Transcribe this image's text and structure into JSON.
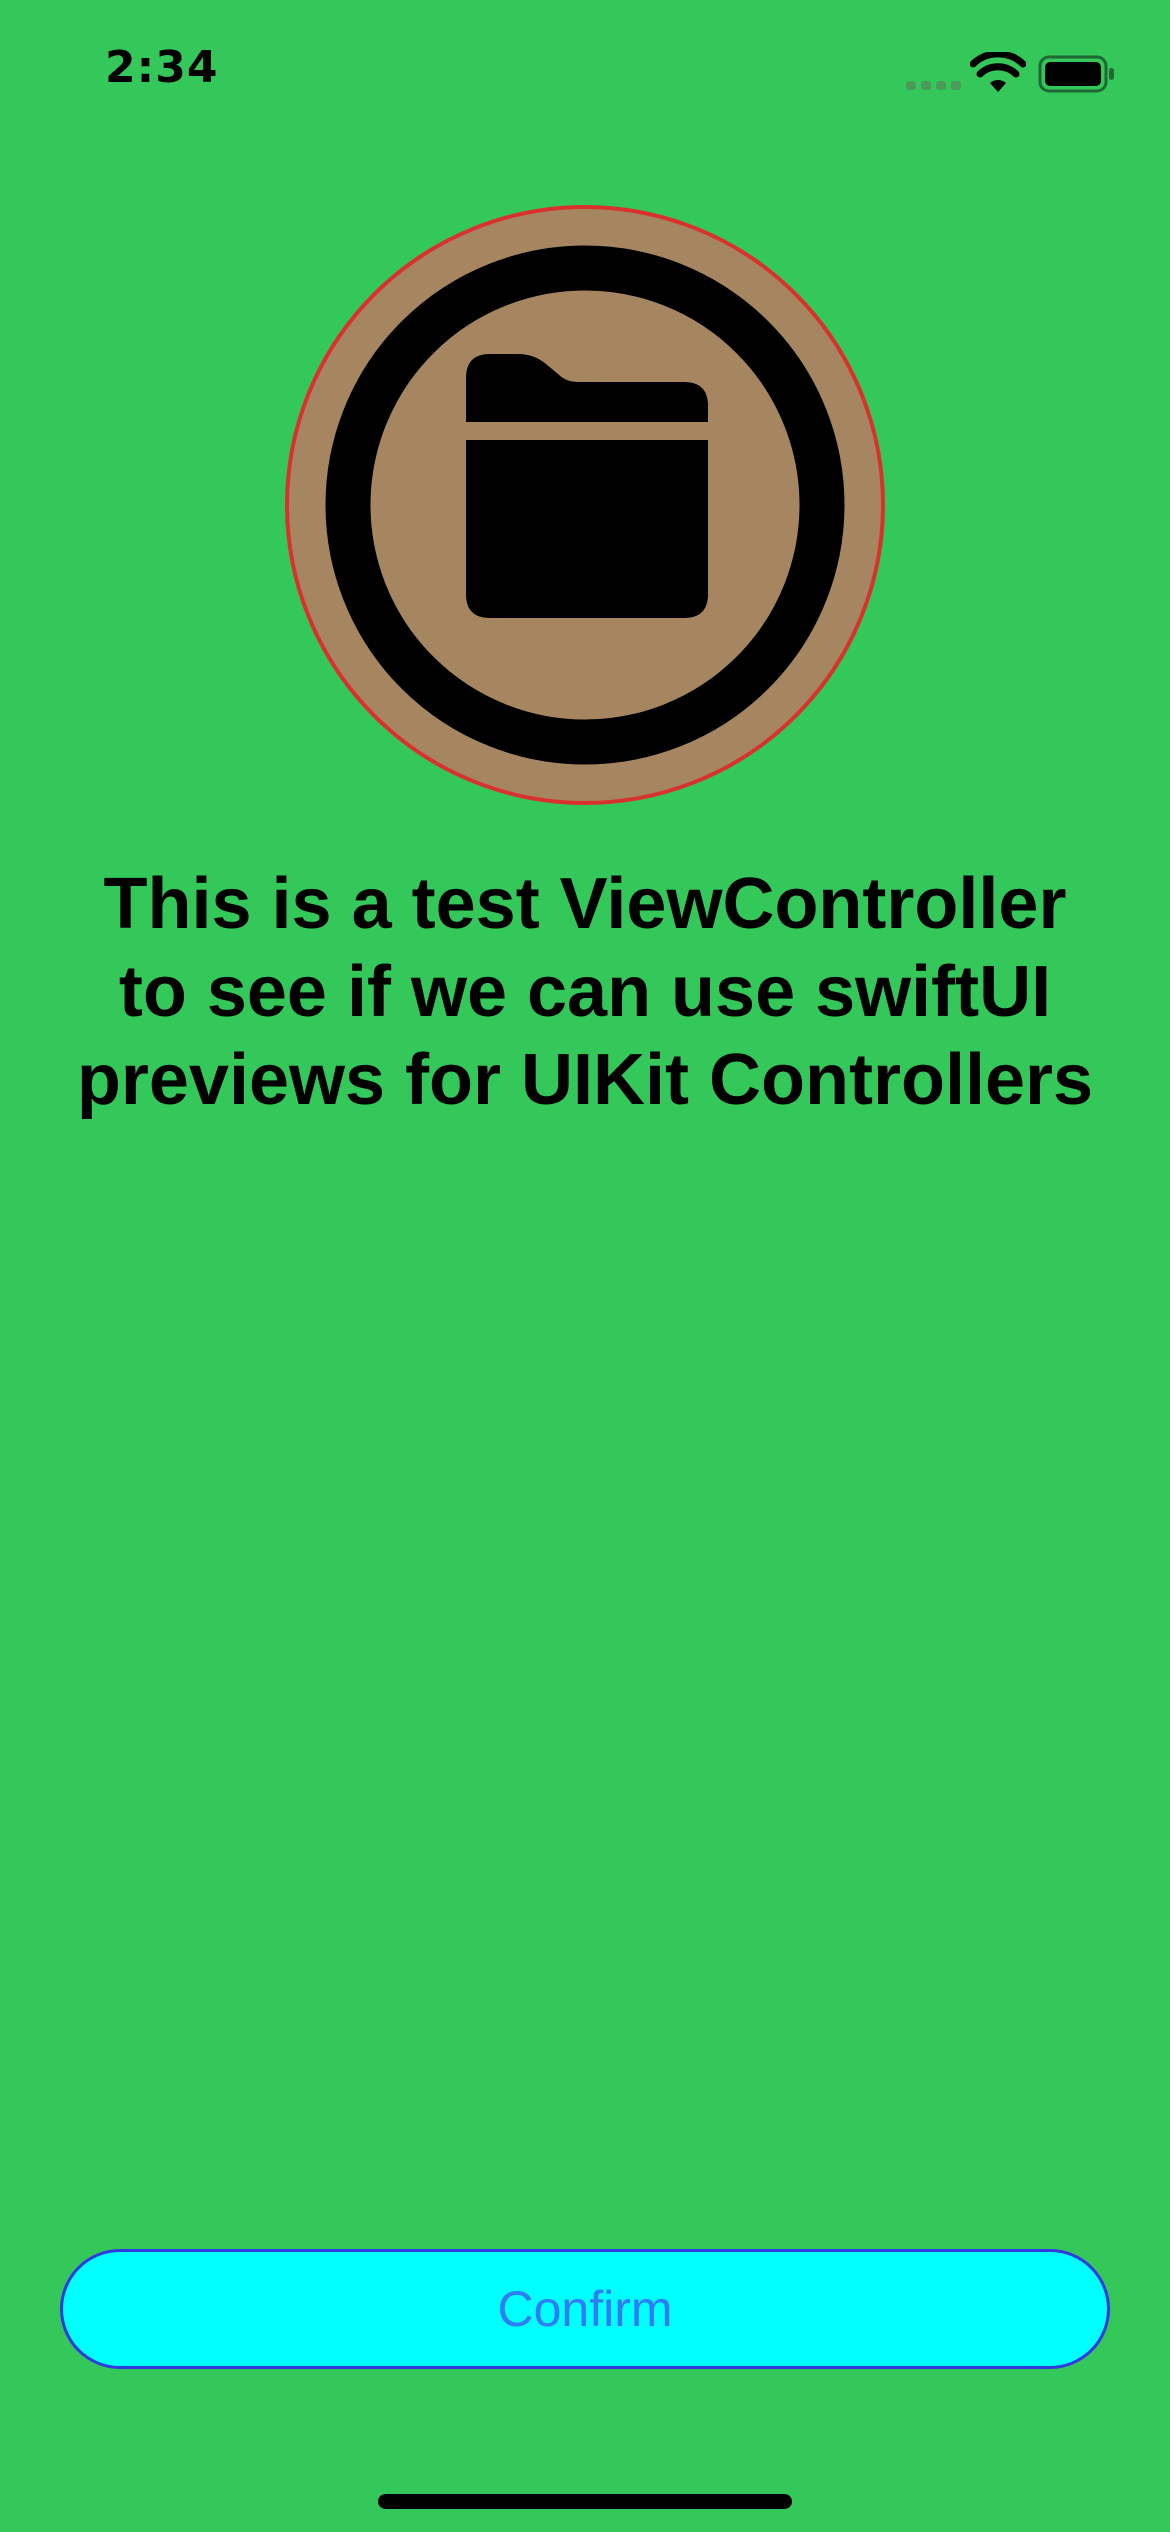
{
  "status_bar": {
    "time": "2:34",
    "icons": [
      "cellular-signal-icon",
      "wifi-icon",
      "battery-icon"
    ]
  },
  "hero": {
    "icon": "folder-circle-icon",
    "colors": {
      "disc_fill": "#A58660",
      "disc_border": "#D9322E",
      "glyph": "#000000"
    }
  },
  "headline": {
    "text": "This is a test ViewController\nto see if we can use swiftUI\npreviews for UIKit Controllers"
  },
  "confirm_button": {
    "label": "Confirm"
  },
  "colors": {
    "background": "#34C759",
    "button_fill": "#00FFFF",
    "button_border": "#2F3BE0",
    "button_text": "#2F7CF6"
  }
}
